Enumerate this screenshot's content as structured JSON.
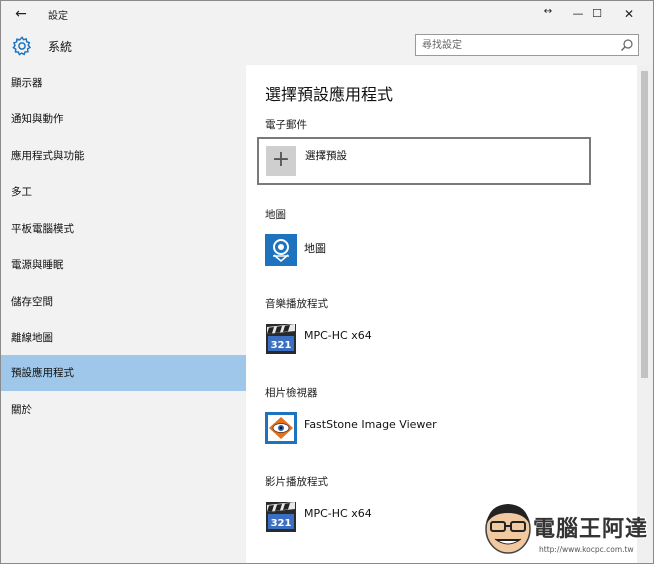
{
  "window": {
    "title": "設定",
    "back_glyph": "←",
    "controls": {
      "resize": "↔",
      "minimize": "—",
      "maximize": "☐",
      "close": "✕"
    }
  },
  "header": {
    "title": "系統",
    "icon": "gear-icon",
    "search": {
      "placeholder": "尋找設定",
      "value": "",
      "icon": "search-icon"
    }
  },
  "sidebar": {
    "items": [
      {
        "label": "顯示器",
        "selected": false
      },
      {
        "label": "通知與動作",
        "selected": false
      },
      {
        "label": "應用程式與功能",
        "selected": false
      },
      {
        "label": "多工",
        "selected": false
      },
      {
        "label": "平板電腦模式",
        "selected": false
      },
      {
        "label": "電源與睡眠",
        "selected": false
      },
      {
        "label": "儲存空間",
        "selected": false
      },
      {
        "label": "離線地圖",
        "selected": false
      },
      {
        "label": "預設應用程式",
        "selected": true
      },
      {
        "label": "關於",
        "selected": false
      }
    ],
    "selected_color": "#9fc7ea"
  },
  "content": {
    "title": "選擇預設應用程式",
    "sections": [
      {
        "label": "電子郵件",
        "app": "選擇預設",
        "icon": "plus-icon"
      },
      {
        "label": "地圖",
        "app": "地圖",
        "icon": "maps-icon"
      },
      {
        "label": "音樂播放程式",
        "app": "MPC-HC x64",
        "icon": "mpc-hc-icon"
      },
      {
        "label": "相片檢視器",
        "app": "FastStone Image Viewer",
        "icon": "faststone-icon"
      },
      {
        "label": "影片播放程式",
        "app": "MPC-HC x64",
        "icon": "mpc-hc-icon"
      }
    ],
    "plus_glyph": "+"
  },
  "watermark": {
    "text": "電腦王阿達",
    "url": "http://www.kocpc.com.tw"
  },
  "colors": {
    "chrome_bg": "#f2f2f2",
    "accent_blue": "#1e73be",
    "selected_nav": "#9fc7ea"
  }
}
